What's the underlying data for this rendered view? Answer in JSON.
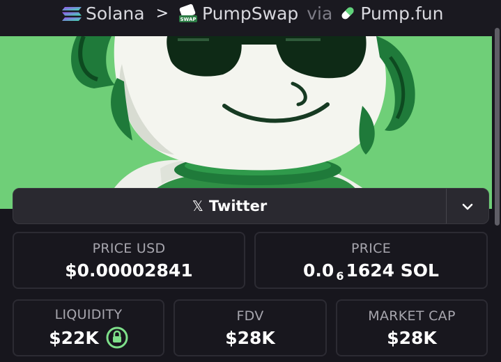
{
  "breadcrumb": {
    "chain": "Solana",
    "dex": "PumpSwap",
    "via": "via",
    "source": "Pump.fun"
  },
  "icons": {
    "chain": "solana-icon",
    "dex": "pumpswap-icon",
    "dex_badge_text": "SWAP",
    "source": "pill-icon",
    "separator": "chevron-right-icon",
    "twitter": "x-logo-icon",
    "dropdown": "chevron-down-icon",
    "liquidity_lock": "lock-icon"
  },
  "social": {
    "twitter_glyph": "𝕏",
    "twitter_label": "Twitter"
  },
  "stats": {
    "price_usd_label": "PRICE USD",
    "price_usd_value": "$0.00002841",
    "price_label": "PRICE",
    "price_value_prefix": "0.0",
    "price_value_zeros": "6",
    "price_value_suffix": "1624 SOL",
    "liquidity_label": "LIQUIDITY",
    "liquidity_value": "$22K",
    "fdv_label": "FDV",
    "fdv_value": "$28K",
    "market_cap_label": "MARKET CAP",
    "market_cap_value": "$28K"
  },
  "colors": {
    "background": "#17161d",
    "banner_green": "#6fcf78",
    "mascot_green": "#1f7a3a",
    "lock_green": "#7ee08a"
  }
}
